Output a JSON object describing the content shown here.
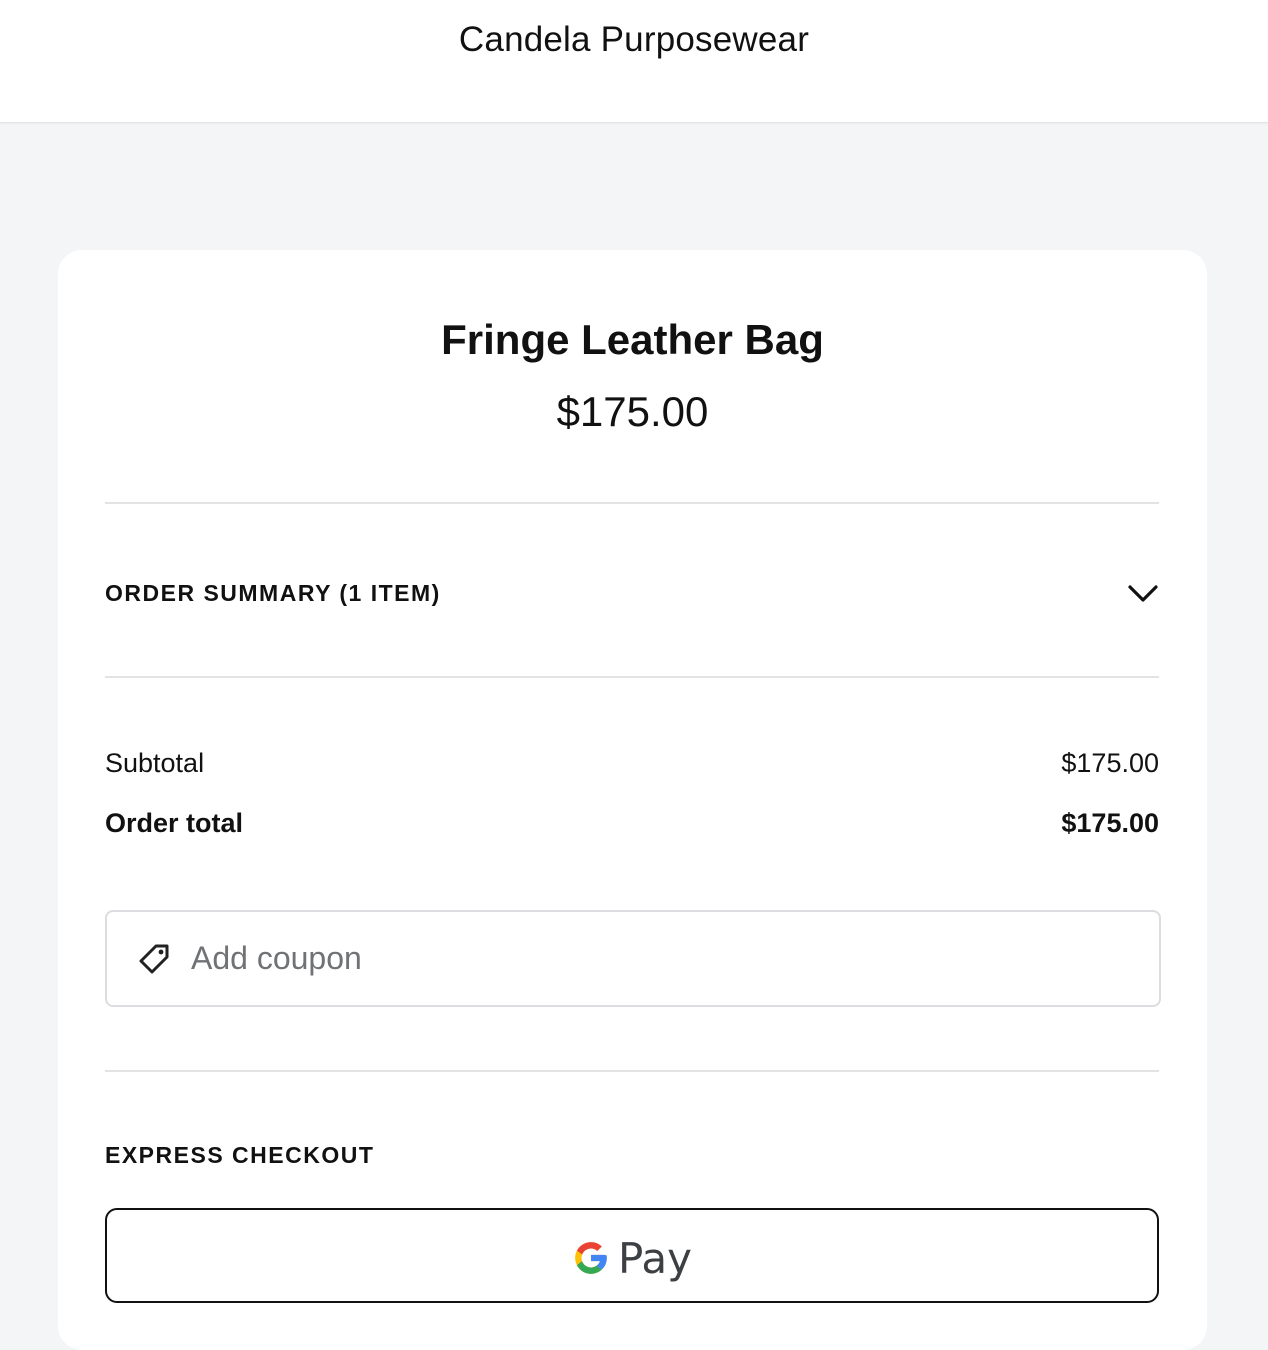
{
  "header": {
    "store_name": "Candela Purposewear"
  },
  "product": {
    "title": "Fringe Leather Bag",
    "price": "$175.00"
  },
  "order_summary": {
    "label": "ORDER SUMMARY (1 ITEM)",
    "toggle_icon": "chevron-down-icon"
  },
  "totals": {
    "subtotal_label": "Subtotal",
    "subtotal_value": "$175.00",
    "total_label": "Order total",
    "total_value": "$175.00"
  },
  "coupon": {
    "icon": "tag-icon",
    "placeholder": "Add coupon"
  },
  "express_checkout": {
    "label": "EXPRESS CHECKOUT",
    "gpay_text": "Pay",
    "gpay_icon": "google-g-icon"
  },
  "colors": {
    "page_background": "#f4f5f6",
    "card_background": "#ffffff",
    "text": "#111111",
    "placeholder": "#707275",
    "divider": "#e2e3e5"
  }
}
